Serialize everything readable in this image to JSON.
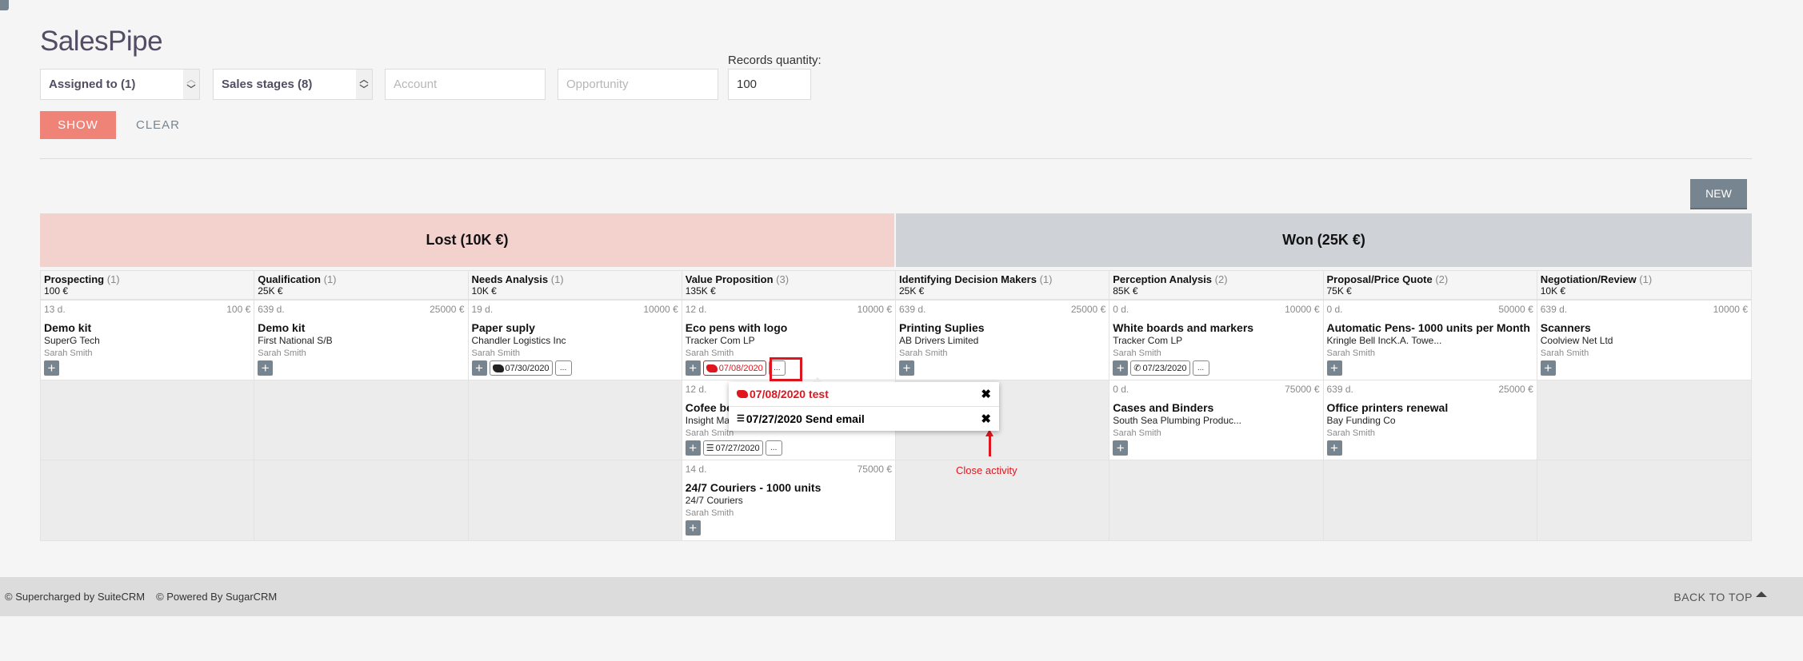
{
  "page": {
    "title": "SalesPipe"
  },
  "filters": {
    "assigned_to": "Assigned to (1)",
    "sales_stages": "Sales stages (8)",
    "account_placeholder": "Account",
    "opportunity_placeholder": "Opportunity",
    "records_label": "Records quantity:",
    "records_value": "100",
    "show_label": "SHOW",
    "clear_label": "CLEAR"
  },
  "toolbar": {
    "new_label": "NEW"
  },
  "groups": {
    "lost": "Lost (10K €)",
    "won": "Won (25K €)"
  },
  "colors": {
    "accent": "#f08377",
    "lost_bg": "#f3d1cd",
    "won_bg": "#cfd3d8",
    "button_gray": "#778591",
    "overdue_red": "#e0161e"
  },
  "stages": [
    {
      "name": "Prospecting",
      "count": "(1)",
      "total": "100 €",
      "cards": [
        {
          "age": "13 d.",
          "amount": "100 €",
          "title": "Demo kit",
          "account": "SuperG Tech",
          "user": "Sarah Smith",
          "activity": null
        }
      ]
    },
    {
      "name": "Qualification",
      "count": "(1)",
      "total": "25K €",
      "cards": [
        {
          "age": "639 d.",
          "amount": "25000 €",
          "title": "Demo kit",
          "account": "First National S/B",
          "user": "Sarah Smith",
          "activity": null
        }
      ]
    },
    {
      "name": "Needs Analysis",
      "count": "(1)",
      "total": "10K €",
      "cards": [
        {
          "age": "19 d.",
          "amount": "10000 €",
          "title": "Paper suply",
          "account": "Chandler Logistics Inc",
          "user": "Sarah Smith",
          "activity": {
            "icon": "handshake-icon",
            "date": "07/30/2020",
            "overdue": false
          }
        }
      ]
    },
    {
      "name": "Value Proposition",
      "count": "(3)",
      "total": "135K €",
      "cards": [
        {
          "age": "12 d.",
          "amount": "10000 €",
          "title": "Eco pens with logo",
          "account": "Tracker Com LP",
          "user": "Sarah Smith",
          "activity": {
            "icon": "handshake-icon",
            "date": "07/08/2020",
            "overdue": true
          }
        },
        {
          "age": "12 d.",
          "amount": "",
          "title": "Cofee beans",
          "account": "Insight Marketing",
          "user": "Sarah Smith",
          "activity": {
            "icon": "tasks-icon",
            "date": "07/27/2020",
            "overdue": false
          }
        },
        {
          "age": "14 d.",
          "amount": "75000 €",
          "title": "24/7 Couriers - 1000 units",
          "account": "24/7 Couriers",
          "user": "Sarah Smith",
          "activity": null
        }
      ]
    },
    {
      "name": "Identifying Decision Makers",
      "count": "(1)",
      "total": "25K €",
      "cards": [
        {
          "age": "639 d.",
          "amount": "25000 €",
          "title": "Printing Suplies",
          "account": "AB Drivers Limited",
          "user": "Sarah Smith",
          "activity": null
        }
      ]
    },
    {
      "name": "Perception Analysis",
      "count": "(2)",
      "total": "85K €",
      "cards": [
        {
          "age": "0 d.",
          "amount": "10000 €",
          "title": "White boards and markers",
          "account": "Tracker Com LP",
          "user": "Sarah Smith",
          "activity": {
            "icon": "phone-icon",
            "date": "07/23/2020",
            "overdue": false
          }
        },
        {
          "age": "0 d.",
          "amount": "75000 €",
          "title": "Cases and Binders",
          "account": "South Sea Plumbing Produc...",
          "user": "Sarah Smith",
          "activity": null
        }
      ]
    },
    {
      "name": "Proposal/Price Quote",
      "count": "(2)",
      "total": "75K €",
      "cards": [
        {
          "age": "0 d.",
          "amount": "50000 €",
          "title": "Automatic Pens- 1000 units per Month",
          "account": "Kringle Bell IncK.A. Towe...",
          "user": "Sarah Smith",
          "activity": null
        },
        {
          "age": "639 d.",
          "amount": "25000 €",
          "title": "Office printers renewal",
          "account": "Bay Funding Co",
          "user": "Sarah Smith",
          "activity": null
        }
      ]
    },
    {
      "name": "Negotiation/Review",
      "count": "(1)",
      "total": "10K €",
      "cards": [
        {
          "age": "639 d.",
          "amount": "10000 €",
          "title": "Scanners",
          "account": "Coolview Net Ltd",
          "user": "Sarah Smith",
          "activity": null
        }
      ]
    }
  ],
  "card_labels": {
    "plus": "+",
    "more": "..."
  },
  "activity_popup": {
    "items": [
      {
        "icon": "handshake-icon",
        "text": "07/08/2020 test",
        "overdue": true,
        "close": "✖"
      },
      {
        "icon": "tasks-icon",
        "text": "07/27/2020 Send email",
        "overdue": false,
        "close": "✖"
      }
    ]
  },
  "annotation": {
    "text": "Close activity"
  },
  "footer": {
    "supercharged": "© Supercharged by SuiteCRM",
    "powered": "© Powered By SugarCRM",
    "back_to_top": "BACK TO TOP"
  }
}
